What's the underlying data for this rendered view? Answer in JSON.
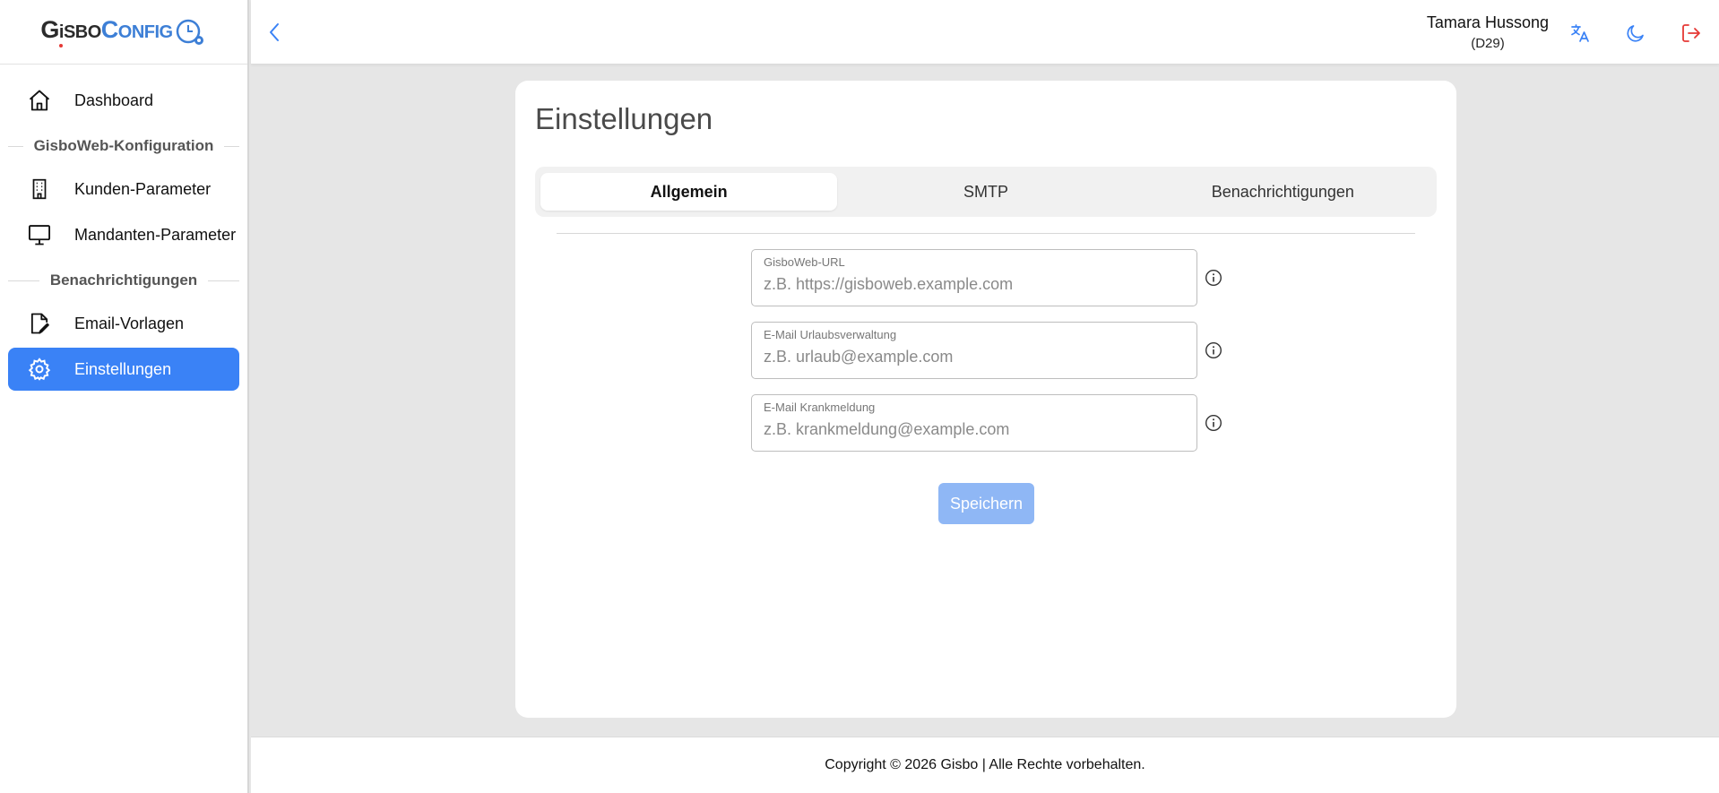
{
  "logo": {
    "gisbo_G": "G",
    "gisbo_i": "i",
    "gisbo_rest": "SBO",
    "config_C": "C",
    "config_rest": "ONFIG"
  },
  "sidebar": {
    "items": [
      {
        "label": "Dashboard",
        "icon": "home-icon"
      },
      {
        "section": "GisboWeb-Konfiguration"
      },
      {
        "label": "Kunden-Parameter",
        "icon": "building-icon"
      },
      {
        "label": "Mandanten-Parameter",
        "icon": "monitor-icon"
      },
      {
        "section": "Benachrichtigungen"
      },
      {
        "label": "Email-Vorlagen",
        "icon": "file-edit-icon"
      },
      {
        "label": "Einstellungen",
        "icon": "gear-icon",
        "active": true
      }
    ]
  },
  "header": {
    "user_name": "Tamara Hussong",
    "user_code": "(D29)",
    "icons": [
      "back-icon",
      "translate-icon",
      "moon-icon",
      "logout-icon"
    ]
  },
  "main": {
    "title": "Einstellungen",
    "tabs": [
      {
        "label": "Allgemein",
        "active": true
      },
      {
        "label": "SMTP"
      },
      {
        "label": "Benachrichtigungen"
      }
    ],
    "fields": [
      {
        "label": "GisboWeb-URL",
        "placeholder": "z.B. https://gisboweb.example.com",
        "value": ""
      },
      {
        "label": "E-Mail Urlaubsverwaltung",
        "placeholder": "z.B. urlaub@example.com",
        "value": ""
      },
      {
        "label": "E-Mail Krankmeldung",
        "placeholder": "z.B. krankmeldung@example.com",
        "value": ""
      }
    ],
    "save_label": "Speichern"
  },
  "footer": {
    "text": "Copyright © 2026 Gisbo | Alle Rechte vorbehalten."
  },
  "colors": {
    "accent": "#3a82f6",
    "save_disabled": "#8fb7f5",
    "logout": "#e53935",
    "logo_blue": "#3d7fd6"
  }
}
